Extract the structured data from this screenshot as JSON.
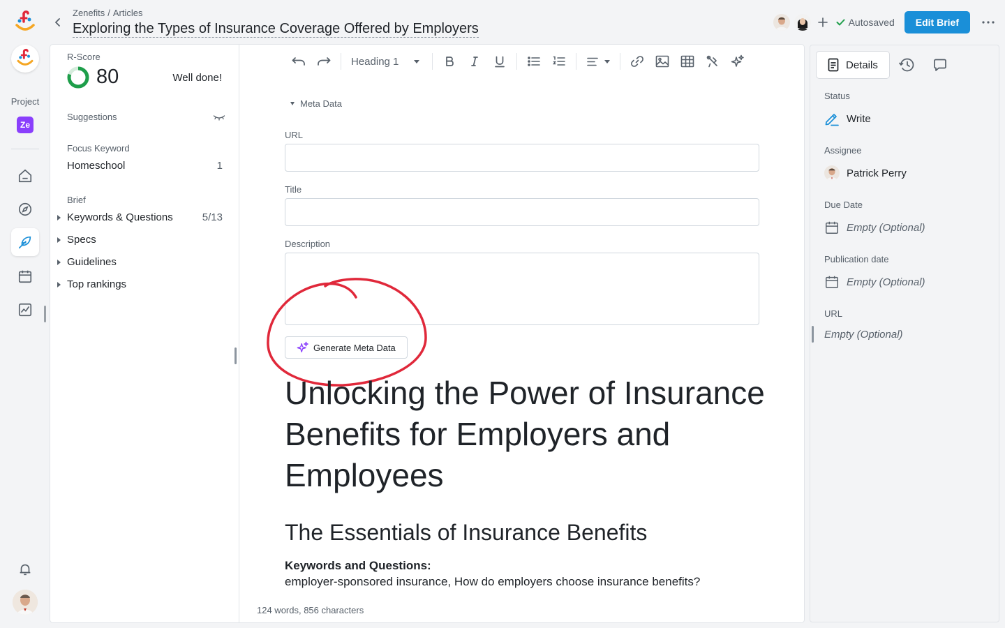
{
  "rail": {
    "project_label": "Project",
    "project_badge": "Ze",
    "nav_items": [
      "home",
      "explore",
      "write",
      "calendar",
      "analytics"
    ]
  },
  "header": {
    "breadcrumb": [
      "Zenefits",
      "Articles"
    ],
    "title": "Exploring the Types of Insurance Coverage Offered by Employers",
    "autosaved": "Autosaved",
    "edit_brief": "Edit Brief"
  },
  "left_panel": {
    "rscore_label": "R-Score",
    "rscore_value": "80",
    "rscore_fraction": 0.8,
    "rscore_message": "Well done!",
    "suggestions_label": "Suggestions",
    "focus_keyword_label": "Focus Keyword",
    "focus_keyword": "Homeschool",
    "focus_keyword_count": "1",
    "brief_label": "Brief",
    "brief_items": [
      {
        "label": "Keywords & Questions",
        "count": "5/13"
      },
      {
        "label": "Specs",
        "count": ""
      },
      {
        "label": "Guidelines",
        "count": ""
      },
      {
        "label": "Top rankings",
        "count": ""
      }
    ]
  },
  "toolbar": {
    "heading_select": "Heading 1"
  },
  "editor": {
    "meta_toggle": "Meta Data",
    "url_label": "URL",
    "url_value": "",
    "title_label": "Title",
    "title_value": "",
    "description_label": "Description",
    "description_value": "",
    "generate_button": "Generate Meta Data",
    "h1": "Unlocking the Power of Insurance Benefits for Employers and Employees",
    "h2": "The Essentials of Insurance Benefits",
    "keywords_title": "Keywords and Questions:",
    "keywords_text": "employer-sponsored insurance, How do employers choose insurance benefits?",
    "word_count": "124 words, 856 characters"
  },
  "right_panel": {
    "tab_details": "Details",
    "status_label": "Status",
    "status_value": "Write",
    "assignee_label": "Assignee",
    "assignee_value": "Patrick Perry",
    "due_date_label": "Due Date",
    "due_date_value": "Empty (Optional)",
    "publication_date_label": "Publication date",
    "publication_date_value": "Empty (Optional)",
    "url_label": "URL",
    "url_value": "Empty (Optional)"
  },
  "colors": {
    "accent": "#1a8fd8",
    "score_green": "#1e9e4a",
    "annotation_red": "#e0283a",
    "brand_purple": "#8a3ffc"
  }
}
